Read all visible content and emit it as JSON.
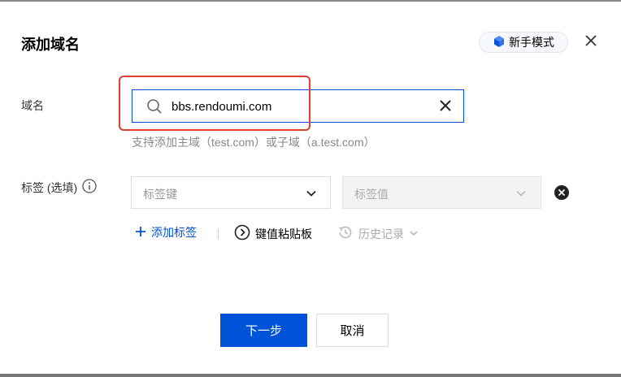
{
  "dialog": {
    "title": "添加域名",
    "guide_label": "新手模式"
  },
  "domain": {
    "label": "域名",
    "value": "bbs.rendoumi.com",
    "hint": "支持添加主域（test.com）或子域（a.test.com）"
  },
  "tags": {
    "label": "标签 (选填)",
    "key_placeholder": "标签键",
    "value_placeholder": "标签值",
    "add_label": "添加标签",
    "paste_label": "键值粘贴板",
    "history_label": "历史记录"
  },
  "footer": {
    "next_label": "下一步",
    "cancel_label": "取消"
  },
  "colors": {
    "primary": "#0052d9",
    "annotation": "#dc3f2e"
  }
}
